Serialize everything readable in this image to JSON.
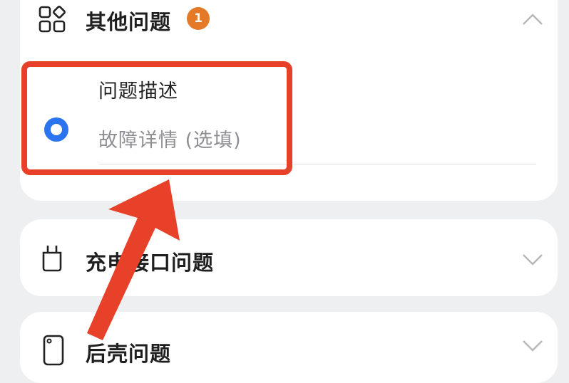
{
  "sections": {
    "other": {
      "title": "其他问题",
      "badge": "1",
      "expanded": true,
      "field_label": "问题描述",
      "field_placeholder": "故障详情 (选填)",
      "icon": "grid-apps-icon"
    },
    "charging": {
      "title": "充电接口问题",
      "expanded": false,
      "icon": "charging-port-icon"
    },
    "back_cover": {
      "title": "后壳问题",
      "expanded": false,
      "icon": "phone-back-icon"
    }
  },
  "colors": {
    "annotation": "#e8412a",
    "badge": "#e47a27",
    "radio": "#2a74ef"
  }
}
